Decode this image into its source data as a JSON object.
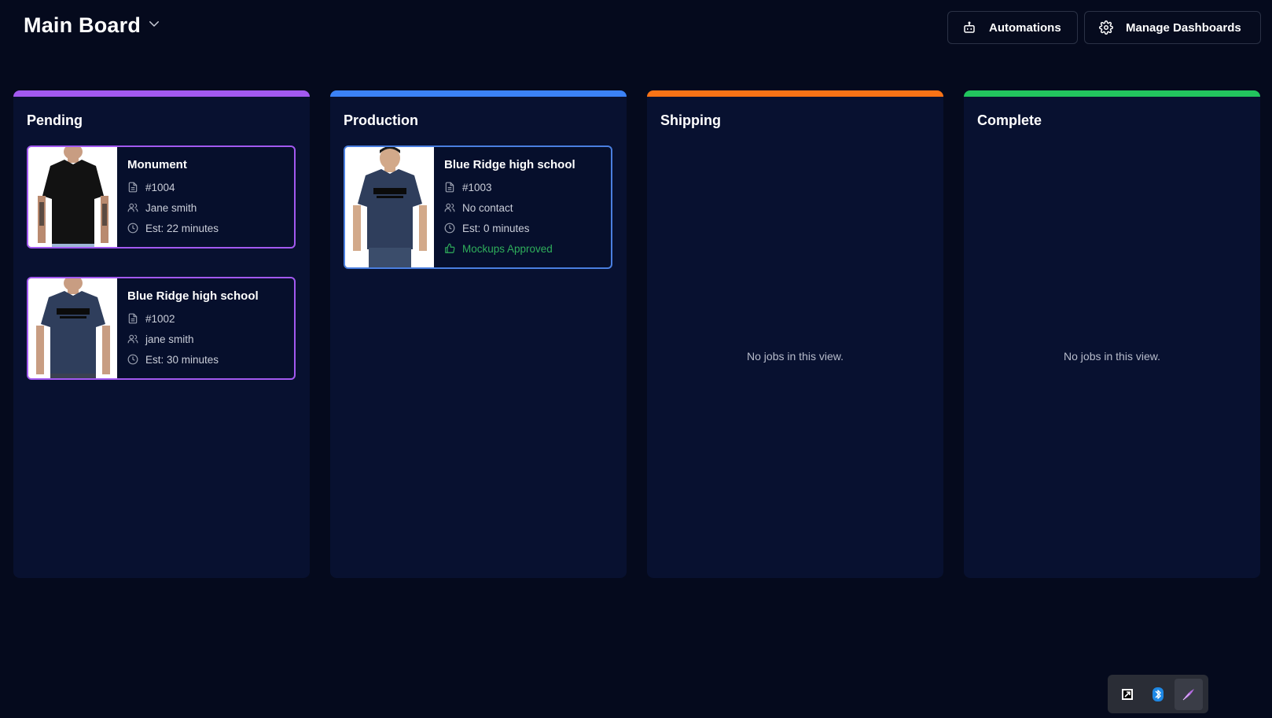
{
  "header": {
    "board_title": "Main Board",
    "automations_label": "Automations",
    "manage_label": "Manage Dashboards"
  },
  "colors": {
    "pending": "#a259f0",
    "production": "#3b82f6",
    "shipping": "#f97316",
    "complete": "#22c55e"
  },
  "columns": [
    {
      "title": "Pending",
      "empty_text": "",
      "cards": [
        {
          "name": "Monument",
          "number": "#1004",
          "contact": "Jane smith",
          "estimate": "Est: 22 minutes",
          "shirt": "black"
        },
        {
          "name": "Blue Ridge high school",
          "number": "#1002",
          "contact": "jane smith",
          "estimate": "Est: 30 minutes",
          "shirt": "navy"
        }
      ]
    },
    {
      "title": "Production",
      "empty_text": "",
      "cards": [
        {
          "name": "Blue Ridge high school",
          "number": "#1003",
          "contact": "No contact",
          "estimate": "Est: 0 minutes",
          "status": "Mockups Approved",
          "shirt": "navy"
        }
      ]
    },
    {
      "title": "Shipping",
      "empty_text": "No jobs in this view.",
      "cards": []
    },
    {
      "title": "Complete",
      "empty_text": "No jobs in this view.",
      "cards": []
    }
  ],
  "tray": {
    "icons": [
      "app-icon",
      "bluetooth-icon",
      "feather-icon"
    ]
  }
}
